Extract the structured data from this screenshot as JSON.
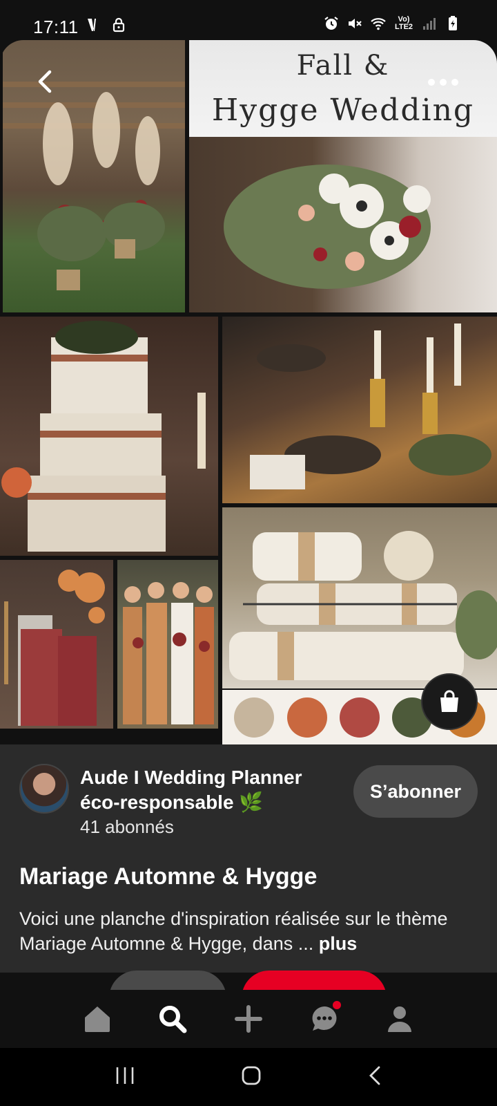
{
  "status_bar": {
    "time": "17:11",
    "network_label": "Vo) LTE2",
    "icons": [
      "v-app-icon",
      "lock-icon",
      "alarm-icon",
      "mute-icon",
      "wifi-icon",
      "signal-icon",
      "battery-icon"
    ]
  },
  "pin": {
    "title_card": {
      "line1": "Fall &",
      "line2": "Hygge Wedding"
    },
    "tiles": [
      {
        "name": "ceremony-aisle-photo",
        "description_icon": "photo"
      },
      {
        "name": "bouquet-photo",
        "description_icon": "photo"
      },
      {
        "name": "wedding-cake-photo",
        "description_icon": "photo"
      },
      {
        "name": "table-setting-photo",
        "description_icon": "photo"
      },
      {
        "name": "invitation-photo",
        "description_icon": "photo"
      },
      {
        "name": "bridesmaids-photo",
        "description_icon": "photo"
      },
      {
        "name": "blankets-photo",
        "description_icon": "photo"
      }
    ],
    "palette": [
      "#c6b59d",
      "#c9683f",
      "#b04a43",
      "#4d5a3a",
      "#c9792e"
    ],
    "back_icon": "chevron-left-icon",
    "more_icon": "more-dots-icon",
    "shop_icon": "shopping-bag-icon"
  },
  "creator": {
    "name": "Aude I Wedding Planner éco-responsable 🌿",
    "followers": "41 abonnés",
    "follow_label": "S’abonner"
  },
  "pin_info": {
    "title": "Mariage Automne & Hygge",
    "description": "Voici une planche d'inspiration réalisée sur le thème Mariage Automne & Hygge, dans ... ",
    "more_label": "plus"
  },
  "bottom_nav": {
    "items": [
      "home-icon",
      "search-icon",
      "plus-icon",
      "messages-icon",
      "profile-icon"
    ],
    "has_message_notification": true
  },
  "system_nav": [
    "recents-icon",
    "home-circle-icon",
    "back-icon"
  ],
  "colors": {
    "accent_red": "#e60023",
    "panel_bg": "#2b2b2b",
    "follow_btn_bg": "#4a4a4a"
  }
}
